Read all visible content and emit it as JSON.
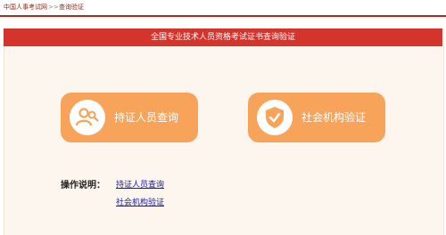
{
  "breadcrumb": {
    "home": "中国人事考试网",
    "separator": ">>",
    "current": "查询验证"
  },
  "panel": {
    "title": "全国专业技术人员资格考试证书查询验证"
  },
  "cards": {
    "cert_query": {
      "label": "持证人员查询",
      "icon": "people-search-icon"
    },
    "org_verify": {
      "label": "社会机构验证",
      "icon": "shield-check-icon"
    }
  },
  "instructions": {
    "title": "操作说明：",
    "link_cert": "持证人员查询",
    "link_org": "社会机构验证"
  },
  "colors": {
    "header_red": "#d4342c",
    "card_orange": "#f7a35a",
    "panel_bg": "#fcf6ef",
    "link_blue": "#1a1aa8"
  }
}
